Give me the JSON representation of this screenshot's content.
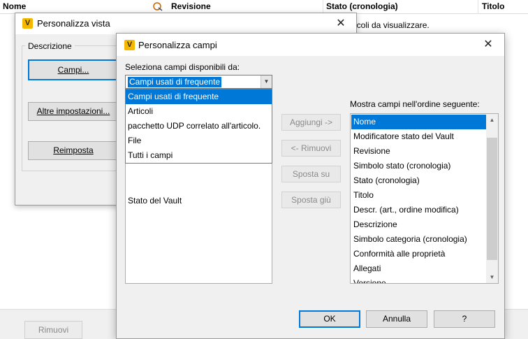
{
  "background": {
    "columns": [
      "Nome",
      "Revisione",
      "Stato (cronologia)",
      "Titolo"
    ],
    "body_text": "icoli da visualizzare.",
    "footer_button": "Rimuovi"
  },
  "dialog_vista": {
    "title": "Personalizza vista",
    "group_label": "Descrizione",
    "buttons": {
      "campi": "Campi...",
      "altre": "Altre impostazioni...",
      "reimposta": "Reimposta"
    }
  },
  "dialog_campi": {
    "title": "Personalizza campi",
    "select_label": "Seleziona campi disponibili da:",
    "combo_value": "Campi usati di frequente",
    "dropdown_options": [
      "Campi usati di frequente",
      "Articoli",
      "pacchetto UDP correlato all'articolo.",
      "File",
      "Tutti i campi"
    ],
    "left_list_visible_item": "Stato del Vault",
    "order_label": "Mostra campi nell'ordine seguente:",
    "ordered_fields": [
      "Nome",
      "Modificatore stato del Vault",
      "Revisione",
      "Simbolo stato (cronologia)",
      "Stato (cronologia)",
      "Titolo",
      "Descr. (art., ordine modifica)",
      "Descrizione",
      "Simbolo categoria (cronologia)",
      "Conformità alle proprietà",
      "Allegati",
      "Versione"
    ],
    "middle_buttons": {
      "aggiungi": "Aggiungi ->",
      "rimuovi": "<- Rimuovi",
      "sposta_su": "Sposta su",
      "sposta_giu": "Sposta giù"
    },
    "ok": "OK",
    "annulla": "Annulla",
    "help": "?"
  },
  "colors": {
    "selection": "#0078d7",
    "dialog_bg": "#f0f0f0",
    "app_icon": "#f4b800"
  },
  "icons": [
    "app-v-icon",
    "close-icon",
    "dropdown-arrow-icon",
    "scroll-up-icon",
    "scroll-down-icon",
    "revision-icon"
  ]
}
